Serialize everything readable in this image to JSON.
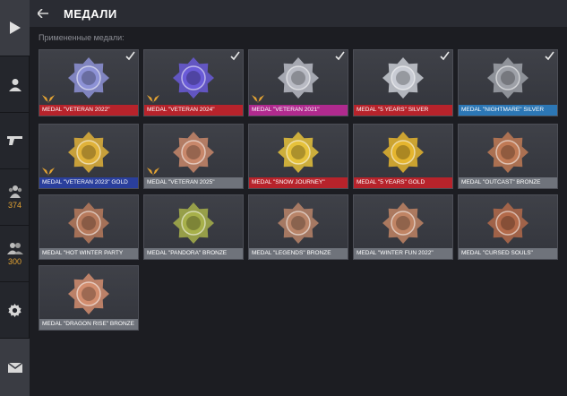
{
  "header": {
    "title": "МЕДАЛИ"
  },
  "section_label": "Примененные медали:",
  "rail": {
    "clan_count": "374",
    "friends_count": "300"
  },
  "medals": [
    {
      "label": "MEDAL \"VETERAN 2022\"",
      "label_color": "#b7232b",
      "applied": true,
      "rank_badge": true,
      "icon": "veteran-2022-medal-icon",
      "tint": "#8d92d6"
    },
    {
      "label": "MEDAL \"VETERAN 2024\"",
      "label_color": "#b7232b",
      "applied": true,
      "rank_badge": true,
      "icon": "veteran-2024-medal-icon",
      "tint": "#6a5bd8"
    },
    {
      "label": "MEDAL \"VETERAN 2021\"",
      "label_color": "#b02a8e",
      "applied": true,
      "rank_badge": true,
      "icon": "veteran-2021-medal-icon",
      "tint": "#b9bbc4"
    },
    {
      "label": "MEDAL \"5 YEARS\" SILVER",
      "label_color": "#b7232b",
      "applied": true,
      "rank_badge": false,
      "icon": "five-years-silver-medal-icon",
      "tint": "#c9ccd4"
    },
    {
      "label": "MEDAL \"NIGHTMARE\" SILVER",
      "label_color": "#2c77b5",
      "applied": true,
      "rank_badge": false,
      "icon": "nightmare-silver-medal-icon",
      "tint": "#9ea1a8"
    },
    {
      "label": "MEDAL \"VETERAN 2023\" GOLD",
      "label_color": "#2a3f9c",
      "applied": false,
      "rank_badge": true,
      "icon": "veteran-2023-gold-medal-icon",
      "tint": "#e0b23a"
    },
    {
      "label": "MEDAL \"VETERAN 2025\"",
      "label_color": "#6f737b",
      "applied": false,
      "rank_badge": true,
      "icon": "veteran-2025-medal-icon",
      "tint": "#c8876a"
    },
    {
      "label": "MEDAL \"SNOW JOURNEY\"",
      "label_color": "#b7232b",
      "applied": false,
      "rank_badge": false,
      "icon": "snow-journey-medal-icon",
      "tint": "#e6c23b"
    },
    {
      "label": "MEDAL \"5 YEARS\" GOLD",
      "label_color": "#b7232b",
      "applied": false,
      "rank_badge": false,
      "icon": "five-years-gold-medal-icon",
      "tint": "#e5b52e"
    },
    {
      "label": "MEDAL \"OUTCAST\" BRONZE",
      "label_color": "#6f737b",
      "applied": false,
      "rank_badge": false,
      "icon": "outcast-bronze-medal-icon",
      "tint": "#c07a55"
    },
    {
      "label": "MEDAL \"HOT WINTER PARTY",
      "label_color": "#6f737b",
      "applied": false,
      "rank_badge": false,
      "icon": "hot-winter-party-medal-icon",
      "tint": "#b77a5c"
    },
    {
      "label": "MEDAL \"PANDORA\" BRONZE",
      "label_color": "#6f737b",
      "applied": false,
      "rank_badge": false,
      "icon": "pandora-bronze-medal-icon",
      "tint": "#a7b04a"
    },
    {
      "label": "MEDAL \"LEGENDS\" BRONZE",
      "label_color": "#6f737b",
      "applied": false,
      "rank_badge": false,
      "icon": "legends-bronze-medal-icon",
      "tint": "#b98468"
    },
    {
      "label": "MEDAL \"WINTER FUN 2022\"",
      "label_color": "#6f737b",
      "applied": false,
      "rank_badge": false,
      "icon": "winter-fun-2022-medal-icon",
      "tint": "#c08464"
    },
    {
      "label": "MEDAL \"CURSED SOULS\"",
      "label_color": "#6f737b",
      "applied": false,
      "rank_badge": false,
      "icon": "cursed-souls-medal-icon",
      "tint": "#b36a4a"
    },
    {
      "label": "MEDAL \"DRAGON RISE\" BRONZE",
      "label_color": "#6f737b",
      "applied": false,
      "rank_badge": false,
      "icon": "dragon-rise-bronze-medal-icon",
      "tint": "#d28d6e"
    }
  ]
}
